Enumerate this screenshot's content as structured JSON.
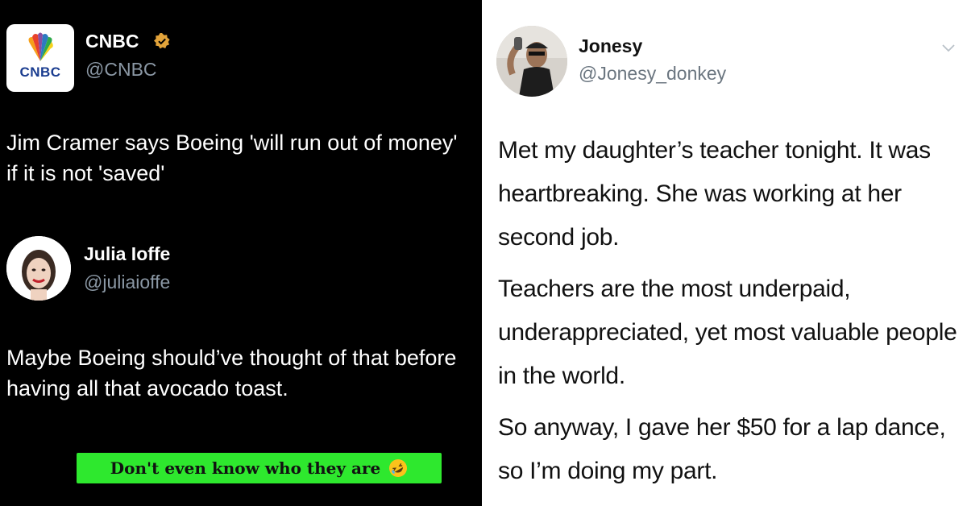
{
  "left_panel": {
    "cnbc_post": {
      "logo_text": "CNBC",
      "display_name": "CNBC",
      "handle": "@CNBC",
      "text": "Jim Cramer says Boeing 'will run out of money' if it is not 'saved'"
    },
    "reply_post": {
      "display_name": "Julia Ioffe",
      "handle": "@juliaioffe",
      "text": "Maybe Boeing should’ve thought of that before having all that avocado toast."
    },
    "caption": {
      "text": "Don't even know who they are",
      "emoji": "rolling-on-floor-laughing-icon"
    },
    "colors": {
      "background": "#000000",
      "handle": "#8b98a5",
      "caption_background": "#2ee82e",
      "verified_badge": "#e2a33a"
    }
  },
  "right_panel": {
    "post": {
      "display_name": "Jonesy",
      "handle": "@Jonesy_donkey",
      "paragraphs": [
        "Met my daughter’s teacher tonight. It was heartbreaking. She was working at her second job.",
        "Teachers are the most underpaid, underappreciated, yet most valuable people in the world.",
        "So anyway, I gave her $50 for a lap dance, so I’m doing my part."
      ]
    },
    "colors": {
      "background": "#ffffff",
      "handle": "#6b7680"
    }
  }
}
